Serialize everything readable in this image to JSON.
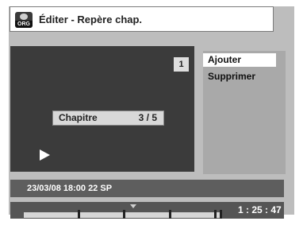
{
  "header": {
    "title": "Éditer - Repère chap.",
    "icon_label": "ORG"
  },
  "preview": {
    "page_number": "1",
    "chapter_label": "Chapitre",
    "chapter_count": "3 / 5"
  },
  "menu": {
    "items": [
      {
        "label": "Ajouter",
        "selected": true
      },
      {
        "label": "Supprimer",
        "selected": false
      }
    ]
  },
  "info": {
    "recording": "23/03/08  18:00  22  SP"
  },
  "progress": {
    "time": "1 : 25 : 47",
    "chapter_marks": 5
  },
  "colors": {
    "panel_gray": "#bdbdbd",
    "preview_dark": "#3b3b3b",
    "selected_highlight": "#ffffff"
  }
}
